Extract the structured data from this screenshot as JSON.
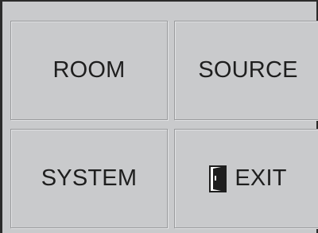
{
  "buttons": {
    "room": "ROOM",
    "source": "SOURCE",
    "system": "SYSTEM",
    "exit": "EXIT"
  },
  "icons": {
    "exit": "door-icon"
  },
  "colors": {
    "panel_background": "#c9cacc",
    "frame": "#2b2b2b",
    "text": "#1e1e1e"
  }
}
